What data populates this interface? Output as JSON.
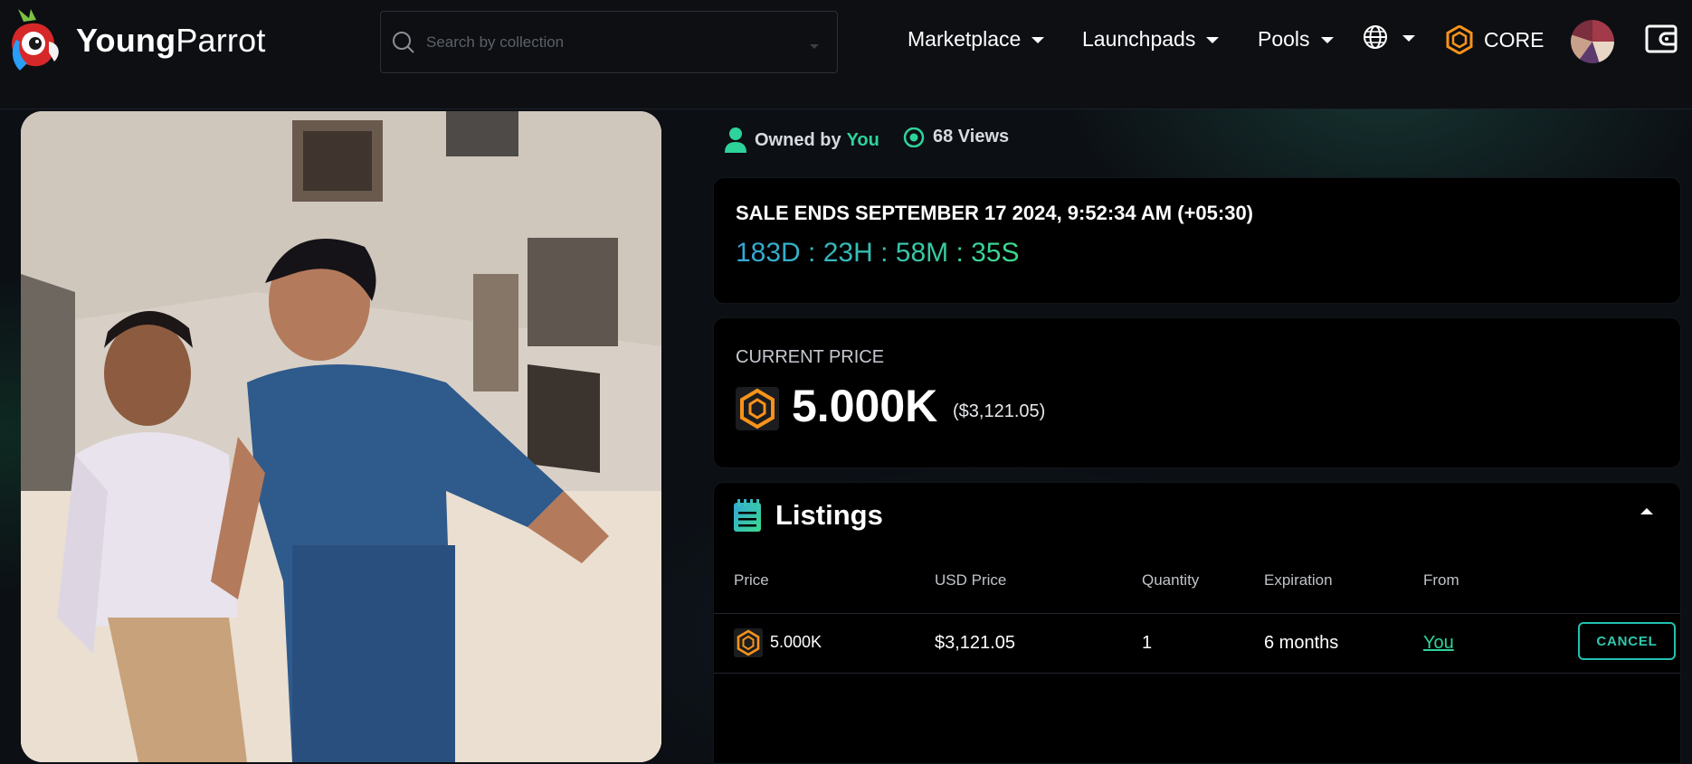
{
  "header": {
    "brand_bold": "Young",
    "brand_light": "Parrot",
    "search_placeholder": "Search by collection",
    "nav": {
      "marketplace": "Marketplace",
      "launchpads": "Launchpads",
      "pools": "Pools"
    },
    "chain_label": "CORE"
  },
  "owner": {
    "prefix": "Owned by",
    "name": "You",
    "views": "68 Views"
  },
  "sale": {
    "title": "SALE ENDS SEPTEMBER 17 2024, 9:52:34 AM (+05:30)",
    "countdown": "183D : 23H : 58M : 35S"
  },
  "price": {
    "label": "CURRENT PRICE",
    "value": "5.000K",
    "usd": "($3,121.05)"
  },
  "listings": {
    "title": "Listings",
    "columns": [
      "Price",
      "USD Price",
      "Quantity",
      "Expiration",
      "From"
    ],
    "rows": [
      {
        "price": "5.000K",
        "usd": "$3,121.05",
        "quantity": "1",
        "expiration": "6 months",
        "from": "You",
        "action": "CANCEL"
      }
    ]
  },
  "colors": {
    "accent_green": "#2ed39a",
    "accent_teal": "#22c1b0",
    "core_orange": "#f7931a"
  }
}
